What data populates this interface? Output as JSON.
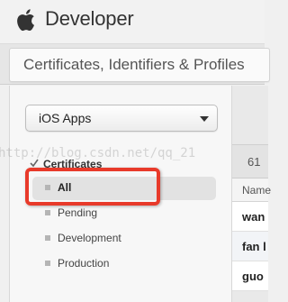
{
  "header": {
    "brand": "Developer",
    "section_title": "Certificates, Identifiers & Profiles"
  },
  "sidebar": {
    "platform_select": {
      "value": "iOS Apps"
    },
    "category": {
      "label": "Certificates",
      "icon": "certificate-icon"
    },
    "items": [
      {
        "label": "All",
        "selected": true
      },
      {
        "label": "Pending",
        "selected": false
      },
      {
        "label": "Development",
        "selected": false
      },
      {
        "label": "Production",
        "selected": false
      }
    ]
  },
  "main": {
    "count_text": "61",
    "column_header": "Name",
    "rows": [
      {
        "name": "wan"
      },
      {
        "name": "fan l"
      },
      {
        "name": "guo"
      }
    ]
  },
  "annotation": {
    "highlight_color": "#e83a2a"
  },
  "watermark": {
    "text": "http://blog.csdn.net/qq_21"
  },
  "colors": {
    "selected_bg": "#e2e2e2",
    "page_bg": "#f0f0f0"
  }
}
